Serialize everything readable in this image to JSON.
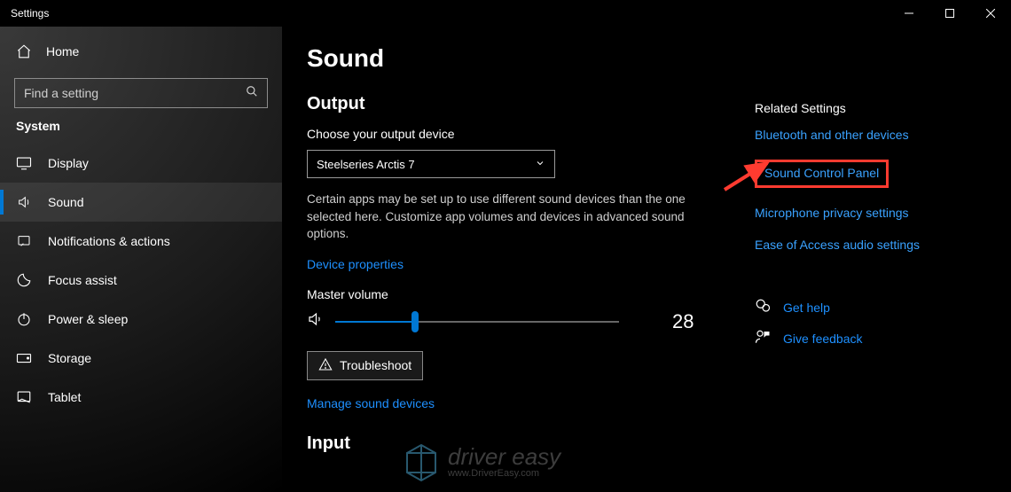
{
  "window": {
    "title": "Settings"
  },
  "sidebar": {
    "home": "Home",
    "search_placeholder": "Find a setting",
    "group": "System",
    "items": [
      {
        "label": "Display"
      },
      {
        "label": "Sound"
      },
      {
        "label": "Notifications & actions"
      },
      {
        "label": "Focus assist"
      },
      {
        "label": "Power & sleep"
      },
      {
        "label": "Storage"
      },
      {
        "label": "Tablet"
      }
    ]
  },
  "page": {
    "title": "Sound",
    "output": {
      "heading": "Output",
      "choose_label": "Choose your output device",
      "device": "Steelseries Arctis 7",
      "description": "Certain apps may be set up to use different sound devices than the one selected here. Customize app volumes and devices in advanced sound options.",
      "device_properties": "Device properties",
      "master_label": "Master volume",
      "volume": 28,
      "troubleshoot": "Troubleshoot",
      "manage": "Manage sound devices"
    },
    "input": {
      "heading": "Input"
    }
  },
  "related": {
    "heading": "Related Settings",
    "links": {
      "bluetooth": "Bluetooth and other devices",
      "sound_cpl": "Sound Control Panel",
      "mic_privacy": "Microphone privacy settings",
      "ease_audio": "Ease of Access audio settings"
    },
    "help": "Get help",
    "feedback": "Give feedback"
  },
  "watermark": {
    "text": "driver easy",
    "sub": "www.DriverEasy.com"
  }
}
